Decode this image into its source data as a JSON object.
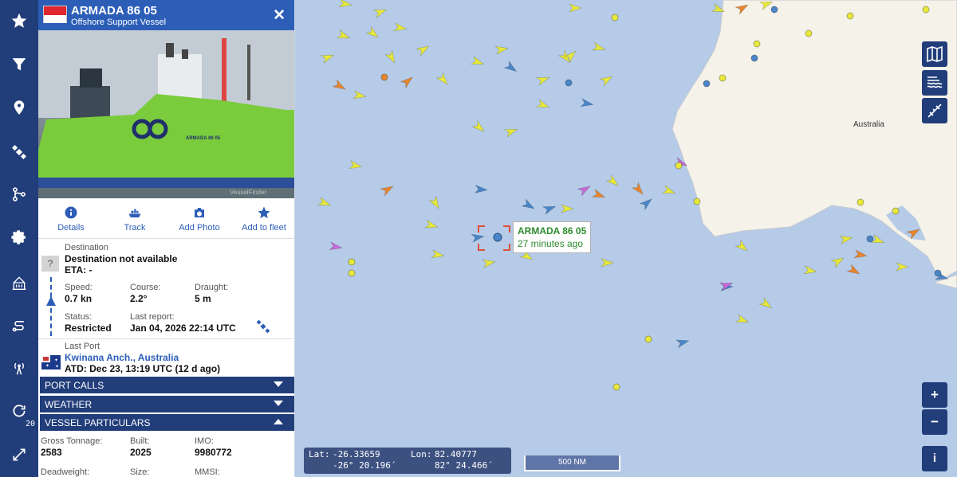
{
  "nav": {
    "refresh_count": "20",
    "items": [
      "favorites-icon",
      "filter-icon",
      "location-pin-icon",
      "satellite-icon",
      "route-graph-icon",
      "settings-icon",
      "port-icon",
      "routes-icon",
      "antenna-icon",
      "refresh-icon",
      "expand-icon"
    ]
  },
  "vessel": {
    "name": "ARMADA 86 05",
    "type": "Offshore Support Vessel",
    "flag": "Singapore",
    "photo_caption": "ARMADA 86 05",
    "photo_watermark": "VesselFinder"
  },
  "actions": {
    "details": "Details",
    "track": "Track",
    "add_photo": "Add Photo",
    "add_to_fleet": "Add to fleet"
  },
  "voyage": {
    "destination_label": "Destination",
    "destination_value": "Destination not available",
    "eta": "ETA: -",
    "unknown_mark": "?",
    "speed_label": "Speed:",
    "speed_value": "0.7 kn",
    "course_label": "Course:",
    "course_value": "2.2°",
    "draught_label": "Draught:",
    "draught_value": "5 m",
    "status_label": "Status:",
    "status_value": "Restricted",
    "last_report_label": "Last report:",
    "last_report_value": "Jan 04, 2026 22:14 UTC",
    "last_port_label": "Last Port",
    "last_port_value": "Kwinana Anch., Australia",
    "atd": "ATD: Dec 23, 13:19 UTC (12 d ago)"
  },
  "sections": {
    "port_calls": "PORT CALLS",
    "weather": "WEATHER",
    "vessel_particulars": "VESSEL PARTICULARS"
  },
  "particulars": {
    "gross_tonnage_label": "Gross Tonnage:",
    "gross_tonnage_value": "2583",
    "built_label": "Built:",
    "built_value": "2025",
    "imo_label": "IMO:",
    "imo_value": "9980772",
    "deadweight_label": "Deadweight:",
    "size_label": "Size:",
    "mmsi_label": "MMSI:"
  },
  "map": {
    "land_label": "Australia",
    "tooltip_name": "ARMADA 86 05",
    "tooltip_time": "27 minutes ago",
    "lat_label": "Lat:",
    "lat_decimal": "-26.33659",
    "lat_dms": "-26° 20.196´",
    "lon_label": "Lon:",
    "lon_decimal": "82.40777",
    "lon_dms": "82° 24.466´",
    "scale": "500 NM",
    "zoom_in": "+",
    "zoom_out": "−",
    "info": "i",
    "colors": {
      "water": "#b5cbe7",
      "land": "#f5f2ea",
      "cargo": "#e8e83a",
      "tanker": "#e8852e",
      "passenger": "#4a86c8",
      "special": "#c86ad8",
      "panel_accent": "#2c5eb8",
      "nav": "#213d7a",
      "highlight": "#e24d3b"
    }
  }
}
